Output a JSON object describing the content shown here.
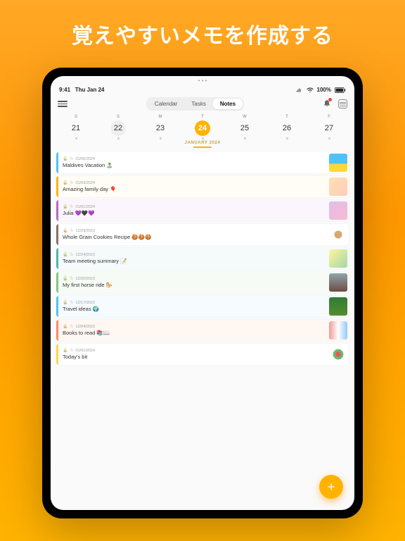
{
  "hero": {
    "title": "覚えやすいメモを作成する"
  },
  "statusbar": {
    "time": "9:41",
    "date": "Thu Jan 24",
    "battery": "100%"
  },
  "tabs": {
    "items": [
      "Calendar",
      "Tasks",
      "Notes"
    ],
    "activeIndex": 2
  },
  "month_label": "JANUARY 2024",
  "week": [
    {
      "dw": "S",
      "dn": "21",
      "sel": false,
      "today": false
    },
    {
      "dw": "S",
      "dn": "22",
      "sel": false,
      "today": true
    },
    {
      "dw": "M",
      "dn": "23",
      "sel": false,
      "today": false
    },
    {
      "dw": "T",
      "dn": "24",
      "sel": true,
      "today": false
    },
    {
      "dw": "W",
      "dn": "25",
      "sel": false,
      "today": false
    },
    {
      "dw": "T",
      "dn": "26",
      "sel": false,
      "today": false
    },
    {
      "dw": "F",
      "dn": "27",
      "sel": false,
      "today": false
    }
  ],
  "notes": [
    {
      "date": "01/06/2024",
      "title": "Maldives Vacation 🏝️",
      "stripe": "#4fc3f7",
      "tint": "#ffffff",
      "thumb": "linear-gradient(180deg,#4fc3f7 55%,#fdd835 55%)"
    },
    {
      "date": "01/03/2024",
      "title": "Amazing family day 🎈",
      "stripe": "#ffb300",
      "tint": "#fffdf5",
      "thumb": "linear-gradient(135deg,#ffe0b2,#ffccbc)"
    },
    {
      "date": "01/01/2024",
      "title": "Julia 💜🖤💜",
      "stripe": "#ba68c8",
      "tint": "#fbf6fe",
      "thumb": "linear-gradient(135deg,#e1bee7,#f8bbd0)"
    },
    {
      "date": "12/29/2023",
      "title": "Whole Grain Cookies Recipe 🍪🍪🍪",
      "stripe": "#8d6e63",
      "tint": "#ffffff",
      "thumb": "radial-gradient(circle,#d7a86e 30%,#fff 30%)"
    },
    {
      "date": "12/24/2023",
      "title": "Team meeting summary 📝",
      "stripe": "#4db6ac",
      "tint": "#f4fbfa",
      "thumb": "linear-gradient(135deg,#fff59d,#a5d6a7)"
    },
    {
      "date": "12/20/2023",
      "title": "My first horse ride 🐎",
      "stripe": "#81c784",
      "tint": "#f6fbf6",
      "thumb": "linear-gradient(180deg,#90a4ae,#6d4c41)"
    },
    {
      "date": "12/17/2023",
      "title": "Travel ideas 🌍",
      "stripe": "#4fc3f7",
      "tint": "#f5fbff",
      "thumb": "linear-gradient(180deg,#2e7d32,#558b2f)"
    },
    {
      "date": "12/04/2023",
      "title": "Books to read 📚📖",
      "stripe": "#ff8a65",
      "tint": "#fff7f2",
      "thumb": "linear-gradient(90deg,#ef9a9a,#fff,#90caf9)"
    },
    {
      "date": "01/01/2024",
      "title": "Today's bit",
      "stripe": "#ffd54f",
      "tint": "#ffffff",
      "thumb": "radial-gradient(circle,#ef5350 20%,#66bb6a 20% 40%,#fff 40%)"
    }
  ]
}
